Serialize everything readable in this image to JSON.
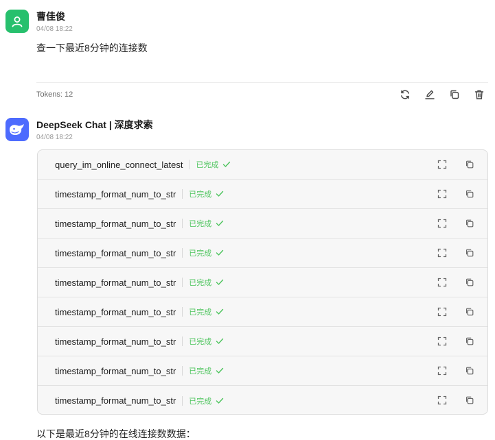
{
  "user_message": {
    "author": "曹佳俊",
    "time": "04/08 18:22",
    "text": "查一下最近8分钟的连接数",
    "tokens": "Tokens: 12",
    "actions": [
      "refresh-icon",
      "edit-icon",
      "copy-icon",
      "delete-icon"
    ]
  },
  "bot_message": {
    "author": "DeepSeek Chat | 深度求索",
    "time": "04/08 18:22",
    "tool_calls": [
      {
        "name": "query_im_online_connect_latest",
        "status": "已完成"
      },
      {
        "name": "timestamp_format_num_to_str",
        "status": "已完成"
      },
      {
        "name": "timestamp_format_num_to_str",
        "status": "已完成"
      },
      {
        "name": "timestamp_format_num_to_str",
        "status": "已完成"
      },
      {
        "name": "timestamp_format_num_to_str",
        "status": "已完成"
      },
      {
        "name": "timestamp_format_num_to_str",
        "status": "已完成"
      },
      {
        "name": "timestamp_format_num_to_str",
        "status": "已完成"
      },
      {
        "name": "timestamp_format_num_to_str",
        "status": "已完成"
      },
      {
        "name": "timestamp_format_num_to_str",
        "status": "已完成"
      }
    ],
    "reply_text": "以下是最近8分钟的在线连接数数据："
  },
  "colors": {
    "user_avatar": "#27c06d",
    "bot_avatar": "#4d6bfe",
    "status_done": "#4cc45c"
  }
}
